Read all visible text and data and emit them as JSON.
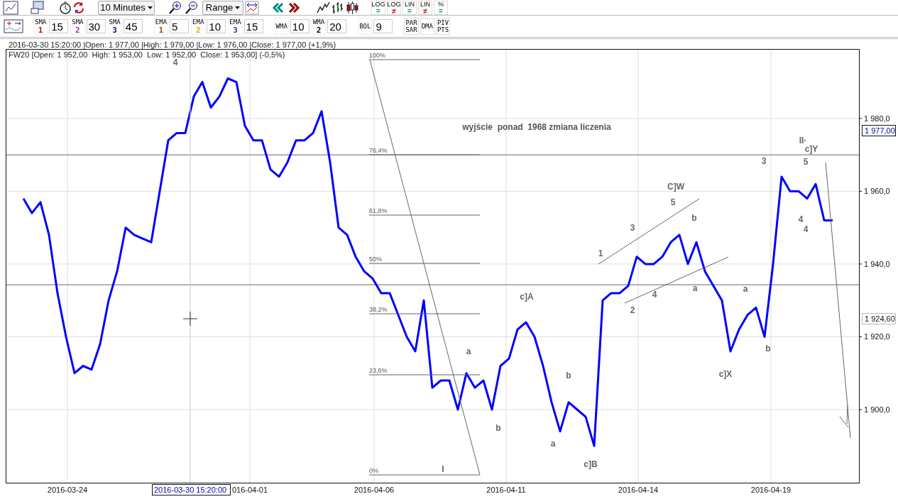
{
  "toolbar": {
    "interval": "10 Minutes",
    "range": "Range",
    "scale_buttons": [
      {
        "top": "LOG",
        "bottom": "=",
        "kind": "equal"
      },
      {
        "top": "LOG",
        "bottom": "≠",
        "kind": "notequal"
      },
      {
        "top": "LIN",
        "bottom": "=",
        "kind": "equal"
      },
      {
        "top": "LIN",
        "bottom": "≠",
        "kind": "notequal"
      },
      {
        "top": "%",
        "bottom": "=",
        "kind": "equal"
      }
    ]
  },
  "indicators": [
    {
      "name": "SMA",
      "index": "1",
      "value": "15",
      "color": "#cc0000"
    },
    {
      "name": "SMA",
      "index": "2",
      "value": "30",
      "color": "#993399"
    },
    {
      "name": "SMA",
      "index": "3",
      "value": "45",
      "color": "#000099"
    },
    {
      "name": "EMA",
      "index": "1",
      "value": "5",
      "color": "#cc3300"
    },
    {
      "name": "EMA",
      "index": "2",
      "value": "10",
      "color": "#ff9900"
    },
    {
      "name": "EMA",
      "index": "3",
      "value": "15",
      "color": "#333399"
    },
    {
      "name": "WMA",
      "value": "10"
    },
    {
      "name": "WMA",
      "index": "2",
      "value": "20",
      "color": "#000000"
    },
    {
      "name": "BOL",
      "value": "9"
    }
  ],
  "study_buttons": [
    [
      "PAR",
      "SAR"
    ],
    [
      "DMA"
    ],
    [
      "PIV",
      "PTS"
    ]
  ],
  "info_line": "2016-03-30 15:20:00 |Open: 1 977,00 |High: 1 979,00 |Low: 1 976,00 |Close: 1 977,00 (+1,9%)",
  "legend": "[Open: 1 952,00  High: 1 953,00  Low: 1 952,00  Close: 1 953,00] (-0,5%)",
  "chart": {
    "chart_data": {
      "type": "line",
      "grid": true,
      "ylim": [
        1879.9,
        1999.1
      ],
      "yticks": [
        {
          "value": 1900,
          "label": "1 900,0"
        },
        {
          "value": 1920,
          "label": "1 920,0"
        },
        {
          "value": 1940,
          "label": "1 940,0"
        },
        {
          "value": 1960,
          "label": "1 960,0"
        },
        {
          "value": 1980,
          "label": "1 980,0"
        }
      ],
      "ref_lines": [
        {
          "axis": "y",
          "value": 1970
        },
        {
          "axis": "y",
          "value": 1934.3
        }
      ],
      "series": [
        {
          "name": "FW20",
          "color": "#0000ff",
          "values": [
            1958,
            1954,
            1957,
            1948,
            1932,
            1920,
            1910,
            1912,
            1911,
            1918,
            1930,
            1938,
            1950,
            1948,
            1947,
            1946,
            1960,
            1974,
            1976,
            1976,
            1986,
            1990,
            1983,
            1986,
            1991,
            1990,
            1978,
            1974,
            1974,
            1966,
            1964,
            1968,
            1974,
            1974,
            1976,
            1982,
            1968,
            1950,
            1948,
            1942,
            1938,
            1936,
            1932,
            1932,
            1926,
            1920,
            1916,
            1930,
            1906,
            1908,
            1908,
            1900,
            1910,
            1906,
            1908,
            1900,
            1912,
            1914,
            1922,
            1924,
            1920,
            1912,
            1902,
            1894,
            1902,
            1900,
            1898,
            1890,
            1930,
            1932,
            1932,
            1934,
            1942,
            1940,
            1940,
            1942,
            1946,
            1948,
            1940,
            1946,
            1938,
            1934,
            1930,
            1916,
            1922,
            1926,
            1928,
            1920,
            1940,
            1964,
            1960,
            1960,
            1958,
            1962,
            1952,
            1952
          ]
        }
      ]
    },
    "date_labels": [
      "2016-03-24",
      "016-04-01",
      "2016-04-06",
      "2016-04-11",
      "2016-04-14",
      "2016-04-19"
    ],
    "price_tags": [
      {
        "label": "1 977,00",
        "kind": "last"
      },
      {
        "label": "1 924,60",
        "kind": "cursor"
      }
    ],
    "cursor_time": "2016-03-30 15:20:00",
    "fib_levels": [
      "100%",
      "76,4%",
      "61,8%",
      "50%",
      "38,2%",
      "23,6%",
      "0%"
    ],
    "note": "wyjście  ponad  1968 zmiana liczenia",
    "wave_labels": [
      "4",
      "II·",
      "c]Y",
      "3",
      "5",
      "C]W",
      "5",
      "b",
      "3",
      "1",
      "4",
      "4",
      "a",
      "a",
      "c]A",
      "4",
      "2",
      "a",
      "b",
      "c]X",
      "b",
      "b",
      "a",
      "c]B",
      "I"
    ]
  }
}
